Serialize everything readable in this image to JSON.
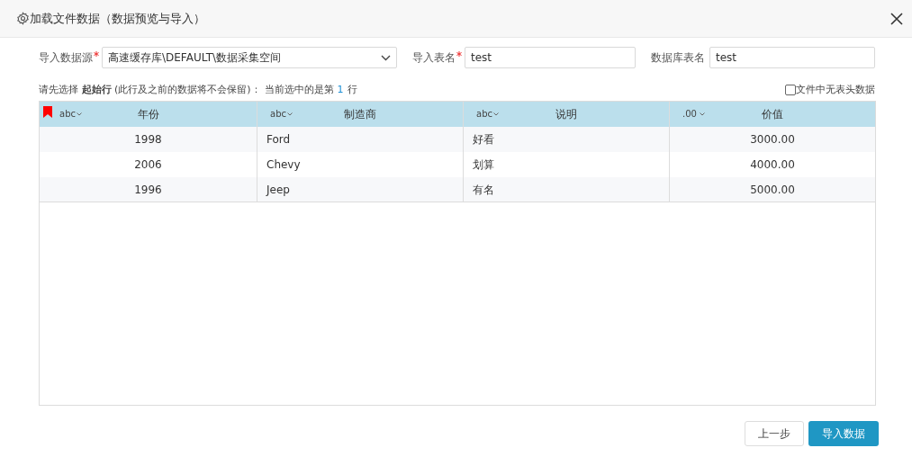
{
  "window": {
    "title": "加载文件数据（数据预览与导入）"
  },
  "form": {
    "source": {
      "label": "导入数据源",
      "required": true,
      "value": "高速缓存库\\DEFAULT\\数据采集空间"
    },
    "table_name": {
      "label": "导入表名",
      "required": true,
      "value": "test"
    },
    "db_table_name": {
      "label": "数据库表名",
      "required": false,
      "value": "test"
    }
  },
  "info": {
    "hint": "请先选择 **起始行** (此行及之前的数据将不会保留)：",
    "current_label": "当前选中的是第",
    "current_row": "1",
    "current_suffix": "行"
  },
  "no_header": {
    "label": "文件中无表头数据",
    "checked": false
  },
  "table": {
    "columns": [
      {
        "type": "abc",
        "name": "年份",
        "kind": "numeric",
        "start_marker": true
      },
      {
        "type": "abc",
        "name": "制造商",
        "kind": "text",
        "start_marker": false
      },
      {
        "type": "abc",
        "name": "说明",
        "kind": "text",
        "start_marker": false
      },
      {
        "type": ".00",
        "name": "价值",
        "kind": "numeric",
        "start_marker": false
      }
    ],
    "rows": [
      [
        "1998",
        "Ford",
        "好看",
        "3000.00"
      ],
      [
        "2006",
        "Chevy",
        "划算",
        "4000.00"
      ],
      [
        "1996",
        "Jeep",
        "有名",
        "5000.00"
      ]
    ]
  },
  "buttons": [
    {
      "label": "上一步",
      "kind": "secondary"
    },
    {
      "label": "导入数据",
      "kind": "primary"
    }
  ]
}
